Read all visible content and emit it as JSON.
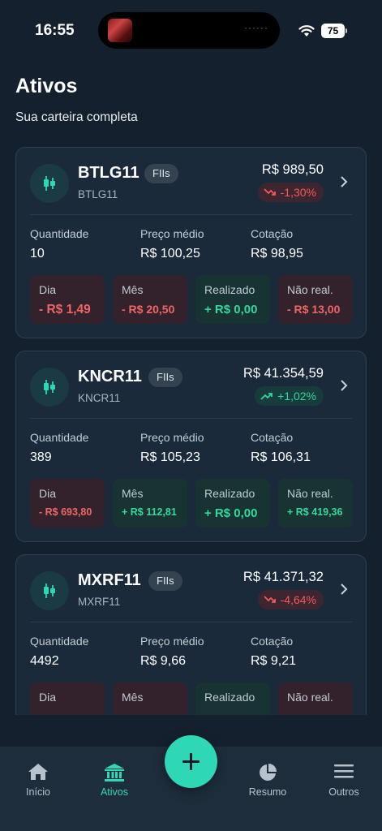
{
  "status": {
    "time": "16:55",
    "battery": "75"
  },
  "header": {
    "title": "Ativos",
    "subtitle": "Sua carteira completa"
  },
  "assets": [
    {
      "ticker": "BTLG11",
      "type": "FIIs",
      "subtitle": "BTLG11",
      "price": "R$ 989,50",
      "change": "-1,30%",
      "direction": "neg",
      "labels": {
        "quantity": "Quantidade",
        "avg_price": "Preço médio",
        "quote": "Cotação"
      },
      "quantity": "10",
      "avg_price": "R$ 100,25",
      "quote": "R$ 98,95",
      "boxes": [
        {
          "label": "Dia",
          "value": "- R$ 1,49",
          "dir": "neg"
        },
        {
          "label": "Mês",
          "value": "- R$ 20,50",
          "dir": "neg"
        },
        {
          "label": "Realizado",
          "value": "+ R$ 0,00",
          "dir": "pos"
        },
        {
          "label": "Não real.",
          "value": "- R$ 13,00",
          "dir": "neg"
        }
      ]
    },
    {
      "ticker": "KNCR11",
      "type": "FIIs",
      "subtitle": "KNCR11",
      "price": "R$ 41.354,59",
      "change": "+1,02%",
      "direction": "pos",
      "labels": {
        "quantity": "Quantidade",
        "avg_price": "Preço médio",
        "quote": "Cotação"
      },
      "quantity": "389",
      "avg_price": "R$ 105,23",
      "quote": "R$ 106,31",
      "boxes": [
        {
          "label": "Dia",
          "value": "- R$ 693,80",
          "dir": "neg"
        },
        {
          "label": "Mês",
          "value": "+ R$ 112,81",
          "dir": "pos"
        },
        {
          "label": "Realizado",
          "value": "+ R$ 0,00",
          "dir": "pos"
        },
        {
          "label": "Não real.",
          "value": "+ R$ 419,36",
          "dir": "pos"
        }
      ]
    },
    {
      "ticker": "MXRF11",
      "type": "FIIs",
      "subtitle": "MXRF11",
      "price": "R$ 41.371,32",
      "change": "-4,64%",
      "direction": "neg",
      "labels": {
        "quantity": "Quantidade",
        "avg_price": "Preço médio",
        "quote": "Cotação"
      },
      "quantity": "4492",
      "avg_price": "R$ 9,66",
      "quote": "R$ 9,21",
      "boxes": [
        {
          "label": "Dia",
          "value": "",
          "dir": "neg"
        },
        {
          "label": "Mês",
          "value": "",
          "dir": "neg"
        },
        {
          "label": "Realizado",
          "value": "",
          "dir": "pos"
        },
        {
          "label": "Não real.",
          "value": "",
          "dir": "neg"
        }
      ]
    }
  ],
  "nav": {
    "home": "Início",
    "assets": "Ativos",
    "summary": "Resumo",
    "others": "Outros"
  },
  "colors": {
    "accent": "#2ed8b6",
    "negative": "#ef5a5a",
    "positive": "#2ed8a0"
  }
}
